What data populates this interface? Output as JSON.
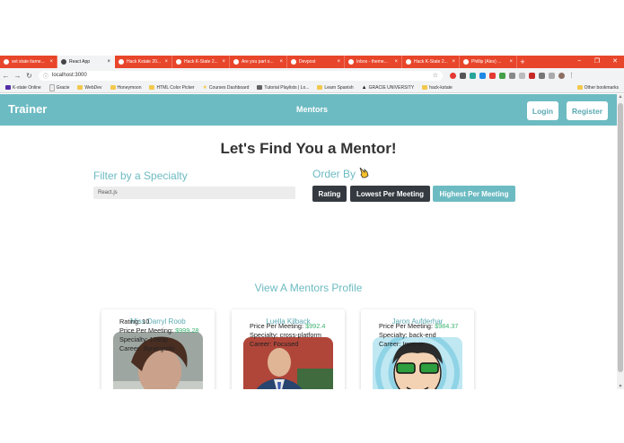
{
  "browser": {
    "tabs": [
      {
        "title": "set state itame...",
        "active": false
      },
      {
        "title": "React App",
        "active": true
      },
      {
        "title": "Hack Kstate 20...",
        "active": false
      },
      {
        "title": "Hack K-State 2...",
        "active": false
      },
      {
        "title": "Are you part o...",
        "active": false
      },
      {
        "title": "Devpost",
        "active": false
      },
      {
        "title": "Inbox - theme...",
        "active": false
      },
      {
        "title": "Hack K-State 2...",
        "active": false
      },
      {
        "title": "Phillip (Alex) ...",
        "active": false
      }
    ],
    "url": "localhost:3000",
    "bookmarks": [
      "K-state Online",
      "Gracie",
      "WebDev",
      "Honeymoon",
      "HTML Color Picker",
      "Courses Dashboard",
      "Tutorial Playlists | Lo...",
      "Learn Spanish",
      "GRACIE UNIVERSITY",
      "hack-kstate"
    ],
    "other_bookmarks": "Other bookmarks"
  },
  "nav": {
    "brand": "Trainer",
    "link": "Mentors",
    "login": "Login",
    "register": "Register"
  },
  "hero": {
    "title": "Let's Find You a Mentor!"
  },
  "filter": {
    "heading": "Filter by a Specialty",
    "value": "React.js"
  },
  "order": {
    "heading": "Order By",
    "buttons": [
      "Rating",
      "Lowest Per Meeting",
      "Highest Per Meeting"
    ]
  },
  "mentors_heading": "View A Mentors Profile",
  "mentors": [
    {
      "name": "Miss Darryl Roob",
      "rating_label": "Rating:",
      "rating": "10",
      "price_label": "Price Per Meeting:",
      "price": "$999.28",
      "specialty_label": "Specialty:",
      "specialty": "1080p",
      "career_label": "Career:",
      "career": "Synergistic"
    },
    {
      "name": "Luella Kilback",
      "price_label": "Price Per Meeting:",
      "price": "$992.4",
      "specialty_label": "Specialty:",
      "specialty": "cross-platform",
      "career_label": "Career:",
      "career": "Focused"
    },
    {
      "name": "Jaron Aufderhar",
      "price_label": "Price Per Meeting:",
      "price": "$984.37",
      "specialty_label": "Specialty:",
      "specialty": "back-end",
      "career_label": "Career:",
      "career": "Inverse"
    }
  ],
  "colors": {
    "accent": "#6dbbc2",
    "dark_button": "#343a40",
    "price": "#3cb371",
    "tabbar": "#e8462b"
  }
}
